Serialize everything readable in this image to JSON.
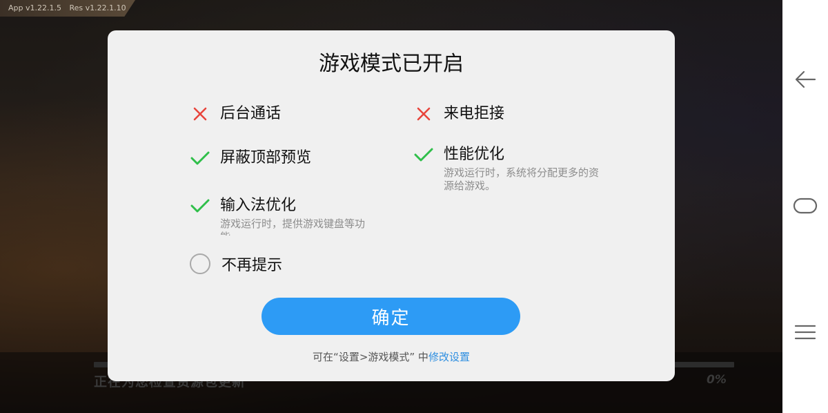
{
  "background": {
    "version_app": "App v1.22.1.5",
    "version_res": "Res v1.22.1.10",
    "loading_text": "正在为您检查资源包更新",
    "loading_percent": "0%"
  },
  "dialog": {
    "title": "游戏模式已开启",
    "features": [
      {
        "label": "后台通话",
        "enabled": false,
        "desc": ""
      },
      {
        "label": "来电拒接",
        "enabled": false,
        "desc": ""
      },
      {
        "label": "屏蔽顶部预览",
        "enabled": true,
        "desc": ""
      },
      {
        "label": "性能优化",
        "enabled": true,
        "desc": "游戏运行时，系统将分配更多的资源给游戏。"
      },
      {
        "label": "输入法优化",
        "enabled": true,
        "desc": "游戏运行时，提供游戏键盘等功能。"
      }
    ],
    "dont_remind_label": "不再提示",
    "dont_remind_checked": false,
    "confirm_label": "确定",
    "hint_prefix": "可在“设置>游戏模式”  中",
    "hint_link": "修改设置"
  },
  "colors": {
    "accent": "#2d9bf5",
    "check": "#2fbf4a",
    "cross": "#e8453c"
  },
  "nav": {
    "icons": [
      "back-arrow-icon",
      "home-icon",
      "menu-icon"
    ]
  }
}
